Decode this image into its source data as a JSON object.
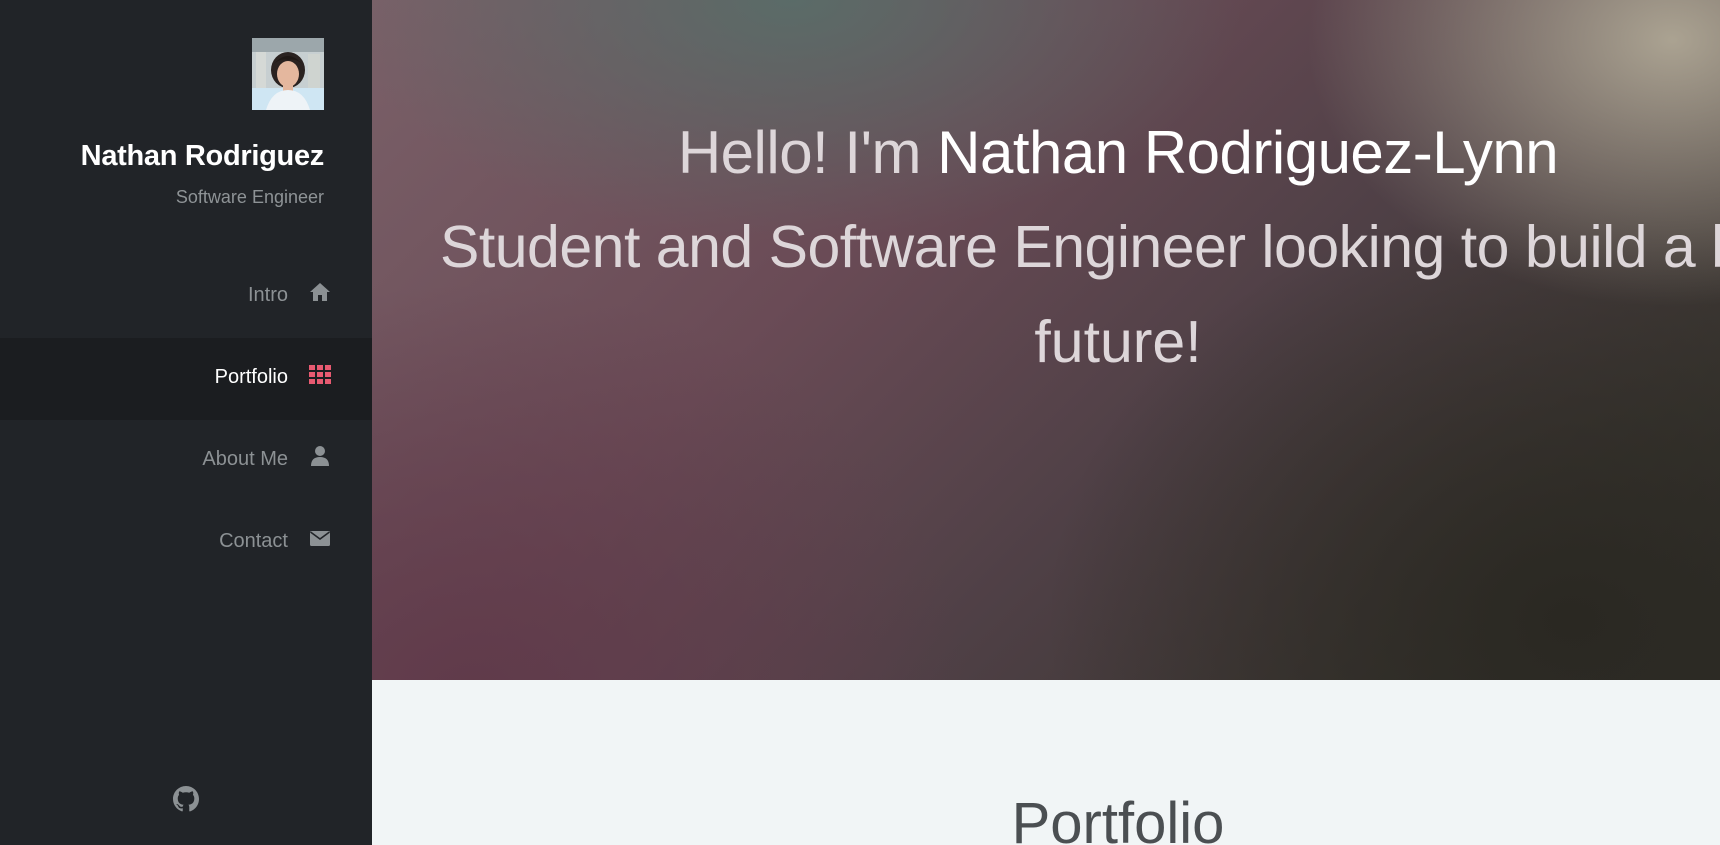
{
  "sidebar": {
    "profile": {
      "name": "Nathan Rodriguez",
      "role": "Software Engineer"
    },
    "nav": [
      {
        "label": "Intro",
        "icon": "home-icon",
        "active": false
      },
      {
        "label": "Portfolio",
        "icon": "grid-icon",
        "active": true
      },
      {
        "label": "About Me",
        "icon": "user-icon",
        "active": false
      },
      {
        "label": "Contact",
        "icon": "envelope-icon",
        "active": false
      }
    ],
    "footer_icon": "github-icon"
  },
  "hero": {
    "greeting": "Hello! I'm ",
    "name": "Nathan Rodriguez-Lynn",
    "tagline_part1": "Student and Software Engineer looking to build a better",
    "tagline_part2": "future!"
  },
  "portfolio": {
    "heading": "Portfolio"
  },
  "colors": {
    "sidebar_bg": "#212428",
    "active_item_bg": "#1b1d20",
    "accent": "#e85a71",
    "section_bg": "#f1f5f6"
  }
}
